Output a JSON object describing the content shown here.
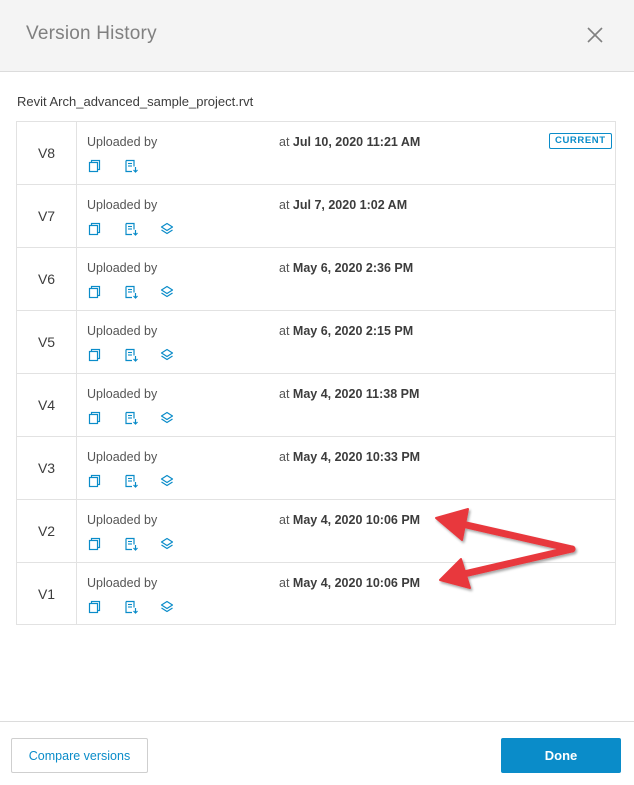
{
  "dialog": {
    "title": "Version History",
    "close_icon": "close-icon"
  },
  "file": {
    "name": "Revit Arch_advanced_sample_project.rvt"
  },
  "versions": [
    {
      "version": "V8",
      "uploaded_label": "Uploaded by",
      "at_label": "at",
      "datetime": "Jul 10, 2020 11:21 AM",
      "badge": "CURRENT",
      "icons": [
        "copy-icon",
        "download-document-icon"
      ]
    },
    {
      "version": "V7",
      "uploaded_label": "Uploaded by",
      "at_label": "at",
      "datetime": "Jul 7, 2020 1:02 AM",
      "icons": [
        "copy-icon",
        "download-document-icon",
        "layers-icon"
      ]
    },
    {
      "version": "V6",
      "uploaded_label": "Uploaded by",
      "at_label": "at",
      "datetime": "May 6, 2020 2:36 PM",
      "icons": [
        "copy-icon",
        "download-document-icon",
        "layers-icon"
      ]
    },
    {
      "version": "V5",
      "uploaded_label": "Uploaded by",
      "at_label": "at",
      "datetime": "May 6, 2020 2:15 PM",
      "icons": [
        "copy-icon",
        "download-document-icon",
        "layers-icon"
      ]
    },
    {
      "version": "V4",
      "uploaded_label": "Uploaded by",
      "at_label": "at",
      "datetime": "May 4, 2020 11:38 PM",
      "icons": [
        "copy-icon",
        "download-document-icon",
        "layers-icon"
      ]
    },
    {
      "version": "V3",
      "uploaded_label": "Uploaded by",
      "at_label": "at",
      "datetime": "May 4, 2020 10:33 PM",
      "icons": [
        "copy-icon",
        "download-document-icon",
        "layers-icon"
      ]
    },
    {
      "version": "V2",
      "uploaded_label": "Uploaded by",
      "at_label": "at",
      "datetime": "May 4, 2020 10:06 PM",
      "icons": [
        "copy-icon",
        "download-document-icon",
        "layers-icon"
      ]
    },
    {
      "version": "V1",
      "uploaded_label": "Uploaded by",
      "at_label": "at",
      "datetime": "May 4, 2020 10:06 PM",
      "icons": [
        "copy-icon",
        "download-document-icon",
        "layers-icon"
      ]
    }
  ],
  "footer": {
    "compare_label": "Compare versions",
    "done_label": "Done"
  },
  "colors": {
    "accent": "#0a8cc9",
    "annotation_arrow": "#e8383d",
    "header_bg": "#f4f4f4"
  },
  "annotations": {
    "arrows": "annotation-arrows"
  }
}
